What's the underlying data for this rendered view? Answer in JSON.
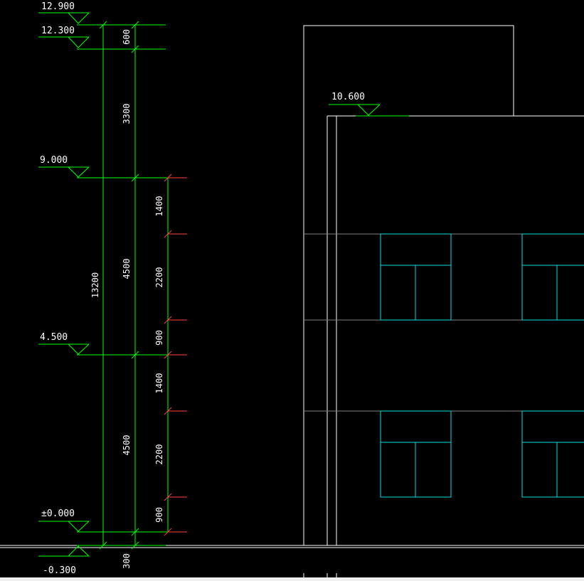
{
  "colors": {
    "background": "#000000",
    "elevation_lines": "#00ff00",
    "dimension_lines": "#00ff00",
    "sub_dimension_ticks": "#ff4040",
    "building_outline": "#ffffff",
    "floor_lines": "#808080",
    "windows": "#00e0e0"
  },
  "elevation_marks": {
    "e12900": "12.900",
    "e12300": "12.300",
    "e10600": "10.600",
    "e9000": "9.000",
    "e4500": "4.500",
    "e0000": "±0.000",
    "em0300": "-0.300"
  },
  "dimensions": {
    "total": "13200",
    "outer": {
      "d600": "600",
      "d3300": "3300",
      "d4500_upper": "4500",
      "d4500_lower": "4500",
      "d300": "300"
    },
    "inner": {
      "d1400_upper": "1400",
      "d2200_upper": "2200",
      "d900_upper": "900",
      "d1400_lower": "1400",
      "d2200_lower": "2200",
      "d900_lower": "900"
    }
  }
}
